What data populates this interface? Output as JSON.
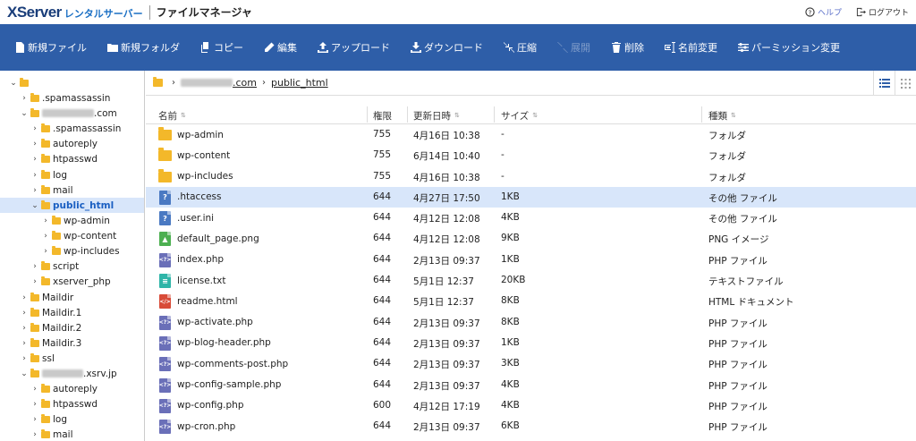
{
  "header": {
    "logo_main": "XServer",
    "logo_sub": "レンタルサーバー",
    "app_title": "ファイルマネージャ",
    "help_label": "ヘルプ",
    "logout_label": "ログアウト"
  },
  "toolbar": {
    "items": [
      {
        "label": "新規ファイル",
        "icon": "new-file-icon",
        "enabled": true
      },
      {
        "label": "新規フォルダ",
        "icon": "new-folder-icon",
        "enabled": true
      },
      {
        "label": "コピー",
        "icon": "copy-icon",
        "enabled": true
      },
      {
        "label": "編集",
        "icon": "edit-icon",
        "enabled": true
      },
      {
        "label": "アップロード",
        "icon": "upload-icon",
        "enabled": true
      },
      {
        "label": "ダウンロード",
        "icon": "download-icon",
        "enabled": true
      },
      {
        "label": "圧縮",
        "icon": "compress-icon",
        "enabled": true
      },
      {
        "label": "展開",
        "icon": "extract-icon",
        "enabled": false
      },
      {
        "label": "削除",
        "icon": "trash-icon",
        "enabled": true
      },
      {
        "label": "名前変更",
        "icon": "rename-icon",
        "enabled": true
      },
      {
        "label": "パーミッション変更",
        "icon": "permission-icon",
        "enabled": true
      }
    ]
  },
  "sidebar": {
    "tree": [
      {
        "label": "",
        "depth": 0,
        "expanded": true,
        "root": true
      },
      {
        "label": ".spamassassin",
        "depth": 1,
        "expanded": false
      },
      {
        "label": ".com",
        "depth": 1,
        "expanded": true,
        "blurred_prefix": true
      },
      {
        "label": ".spamassassin",
        "depth": 2,
        "expanded": false
      },
      {
        "label": "autoreply",
        "depth": 2,
        "expanded": false
      },
      {
        "label": "htpasswd",
        "depth": 2,
        "expanded": false
      },
      {
        "label": "log",
        "depth": 2,
        "expanded": false
      },
      {
        "label": "mail",
        "depth": 2,
        "expanded": false
      },
      {
        "label": "public_html",
        "depth": 2,
        "expanded": true,
        "selected": true
      },
      {
        "label": "wp-admin",
        "depth": 3,
        "expanded": false
      },
      {
        "label": "wp-content",
        "depth": 3,
        "expanded": false
      },
      {
        "label": "wp-includes",
        "depth": 3,
        "expanded": false
      },
      {
        "label": "script",
        "depth": 2,
        "expanded": false
      },
      {
        "label": "xserver_php",
        "depth": 2,
        "expanded": false
      },
      {
        "label": "Maildir",
        "depth": 1,
        "expanded": false
      },
      {
        "label": "Maildir.1",
        "depth": 1,
        "expanded": false
      },
      {
        "label": "Maildir.2",
        "depth": 1,
        "expanded": false
      },
      {
        "label": "Maildir.3",
        "depth": 1,
        "expanded": false
      },
      {
        "label": "ssl",
        "depth": 1,
        "expanded": false
      },
      {
        "label": ".xsrv.jp",
        "depth": 1,
        "expanded": true,
        "blurred_prefix": true
      },
      {
        "label": "autoreply",
        "depth": 2,
        "expanded": false
      },
      {
        "label": "htpasswd",
        "depth": 2,
        "expanded": false
      },
      {
        "label": "log",
        "depth": 2,
        "expanded": false
      },
      {
        "label": "mail",
        "depth": 2,
        "expanded": false
      }
    ]
  },
  "breadcrumb": {
    "domain_suffix": ".com",
    "current": "public_html"
  },
  "table": {
    "columns": {
      "name": "名前",
      "perm": "権限",
      "modified": "更新日時",
      "size": "サイズ",
      "type": "種類"
    },
    "rows": [
      {
        "name": "wp-admin",
        "perm": "755",
        "modified": "4月16日 10:38",
        "size": "-",
        "type": "フォルダ",
        "icon": "folder"
      },
      {
        "name": "wp-content",
        "perm": "755",
        "modified": "6月14日 10:40",
        "size": "-",
        "type": "フォルダ",
        "icon": "folder"
      },
      {
        "name": "wp-includes",
        "perm": "755",
        "modified": "4月16日 10:38",
        "size": "-",
        "type": "フォルダ",
        "icon": "folder"
      },
      {
        "name": ".htaccess",
        "perm": "644",
        "modified": "4月27日 17:50",
        "size": "1KB",
        "type": "その他 ファイル",
        "icon": "unknown",
        "selected": true
      },
      {
        "name": ".user.ini",
        "perm": "644",
        "modified": "4月12日 12:08",
        "size": "4KB",
        "type": "その他 ファイル",
        "icon": "unknown"
      },
      {
        "name": "default_page.png",
        "perm": "644",
        "modified": "4月12日 12:08",
        "size": "9KB",
        "type": "PNG イメージ",
        "icon": "image"
      },
      {
        "name": "index.php",
        "perm": "644",
        "modified": "2月13日 09:37",
        "size": "1KB",
        "type": "PHP ファイル",
        "icon": "php"
      },
      {
        "name": "license.txt",
        "perm": "644",
        "modified": "5月1日 12:37",
        "size": "20KB",
        "type": "テキストファイル",
        "icon": "text"
      },
      {
        "name": "readme.html",
        "perm": "644",
        "modified": "5月1日 12:37",
        "size": "8KB",
        "type": "HTML ドキュメント",
        "icon": "html"
      },
      {
        "name": "wp-activate.php",
        "perm": "644",
        "modified": "2月13日 09:37",
        "size": "8KB",
        "type": "PHP ファイル",
        "icon": "php"
      },
      {
        "name": "wp-blog-header.php",
        "perm": "644",
        "modified": "2月13日 09:37",
        "size": "1KB",
        "type": "PHP ファイル",
        "icon": "php"
      },
      {
        "name": "wp-comments-post.php",
        "perm": "644",
        "modified": "2月13日 09:37",
        "size": "3KB",
        "type": "PHP ファイル",
        "icon": "php"
      },
      {
        "name": "wp-config-sample.php",
        "perm": "644",
        "modified": "2月13日 09:37",
        "size": "4KB",
        "type": "PHP ファイル",
        "icon": "php"
      },
      {
        "name": "wp-config.php",
        "perm": "600",
        "modified": "4月12日 17:19",
        "size": "4KB",
        "type": "PHP ファイル",
        "icon": "php"
      },
      {
        "name": "wp-cron.php",
        "perm": "644",
        "modified": "2月13日 09:37",
        "size": "6KB",
        "type": "PHP ファイル",
        "icon": "php"
      }
    ]
  },
  "colors": {
    "toolbar_bg": "#2e5ea8",
    "selected_bg": "#d8e6fa",
    "folder": "#f3b82a",
    "accent_link": "#1a5fc2"
  }
}
